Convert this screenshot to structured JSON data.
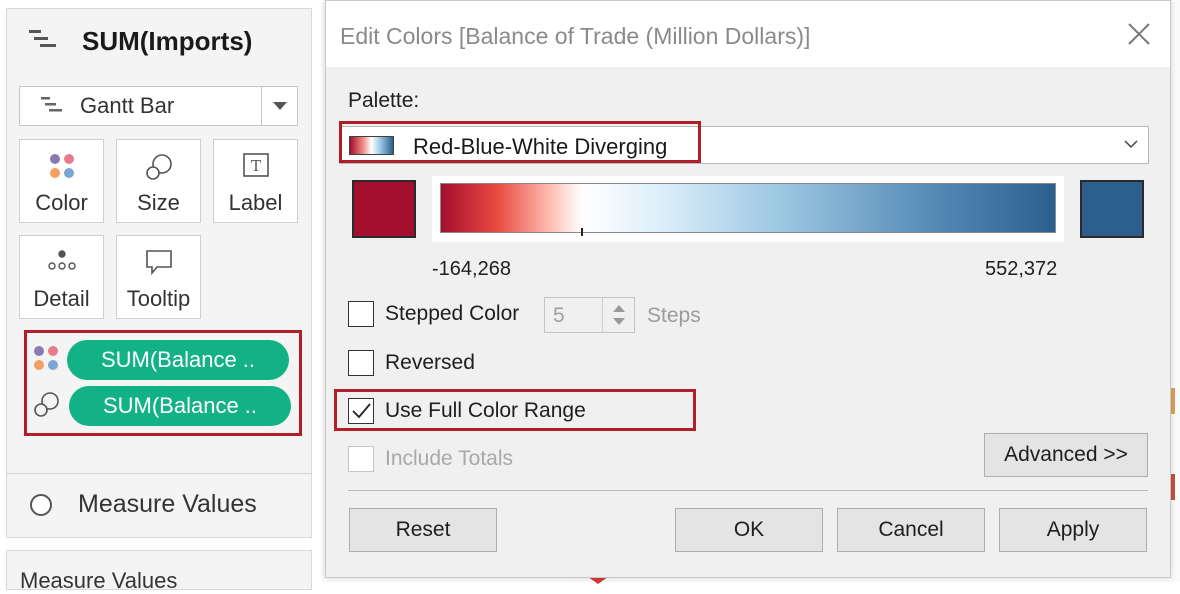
{
  "marks_pane": {
    "header_title": "SUM(Imports)",
    "mark_type": "Gantt Bar",
    "cards": [
      {
        "label": "Color",
        "icon": "color-dots-icon"
      },
      {
        "label": "Size",
        "icon": "size-circles-icon"
      },
      {
        "label": "Label",
        "icon": "text-label-icon"
      },
      {
        "label": "Detail",
        "icon": "detail-dots-icon"
      },
      {
        "label": "Tooltip",
        "icon": "speech-bubble-icon"
      }
    ],
    "pills": [
      {
        "text": "SUM(Balance ..",
        "icon": "color-dots-icon"
      },
      {
        "text": "SUM(Balance ..",
        "icon": "size-circles-icon"
      }
    ],
    "measure_values_row": "Measure Values",
    "measure_values_card": "Measure Values"
  },
  "dialog": {
    "title": "Edit Colors [Balance of Trade (Million Dollars)]",
    "palette_label": "Palette:",
    "palette_selected": "Red-Blue-White Diverging",
    "start_color": "#a40e2f",
    "end_color": "#2c5f8d",
    "range_min": "-164,268",
    "range_max": "552,372",
    "stepped_color_label": "Stepped Color",
    "stepped_color_checked": false,
    "steps_value": "5",
    "steps_label": "Steps",
    "reversed_label": "Reversed",
    "reversed_checked": false,
    "full_range_label": "Use Full Color Range",
    "full_range_checked": true,
    "include_totals_label": "Include Totals",
    "include_totals_checked": false,
    "advanced_label": "Advanced >>",
    "buttons": {
      "reset": "Reset",
      "ok": "OK",
      "cancel": "Cancel",
      "apply": "Apply"
    }
  },
  "colors": {
    "pill": "#12b286",
    "highlight": "#b01e28"
  }
}
